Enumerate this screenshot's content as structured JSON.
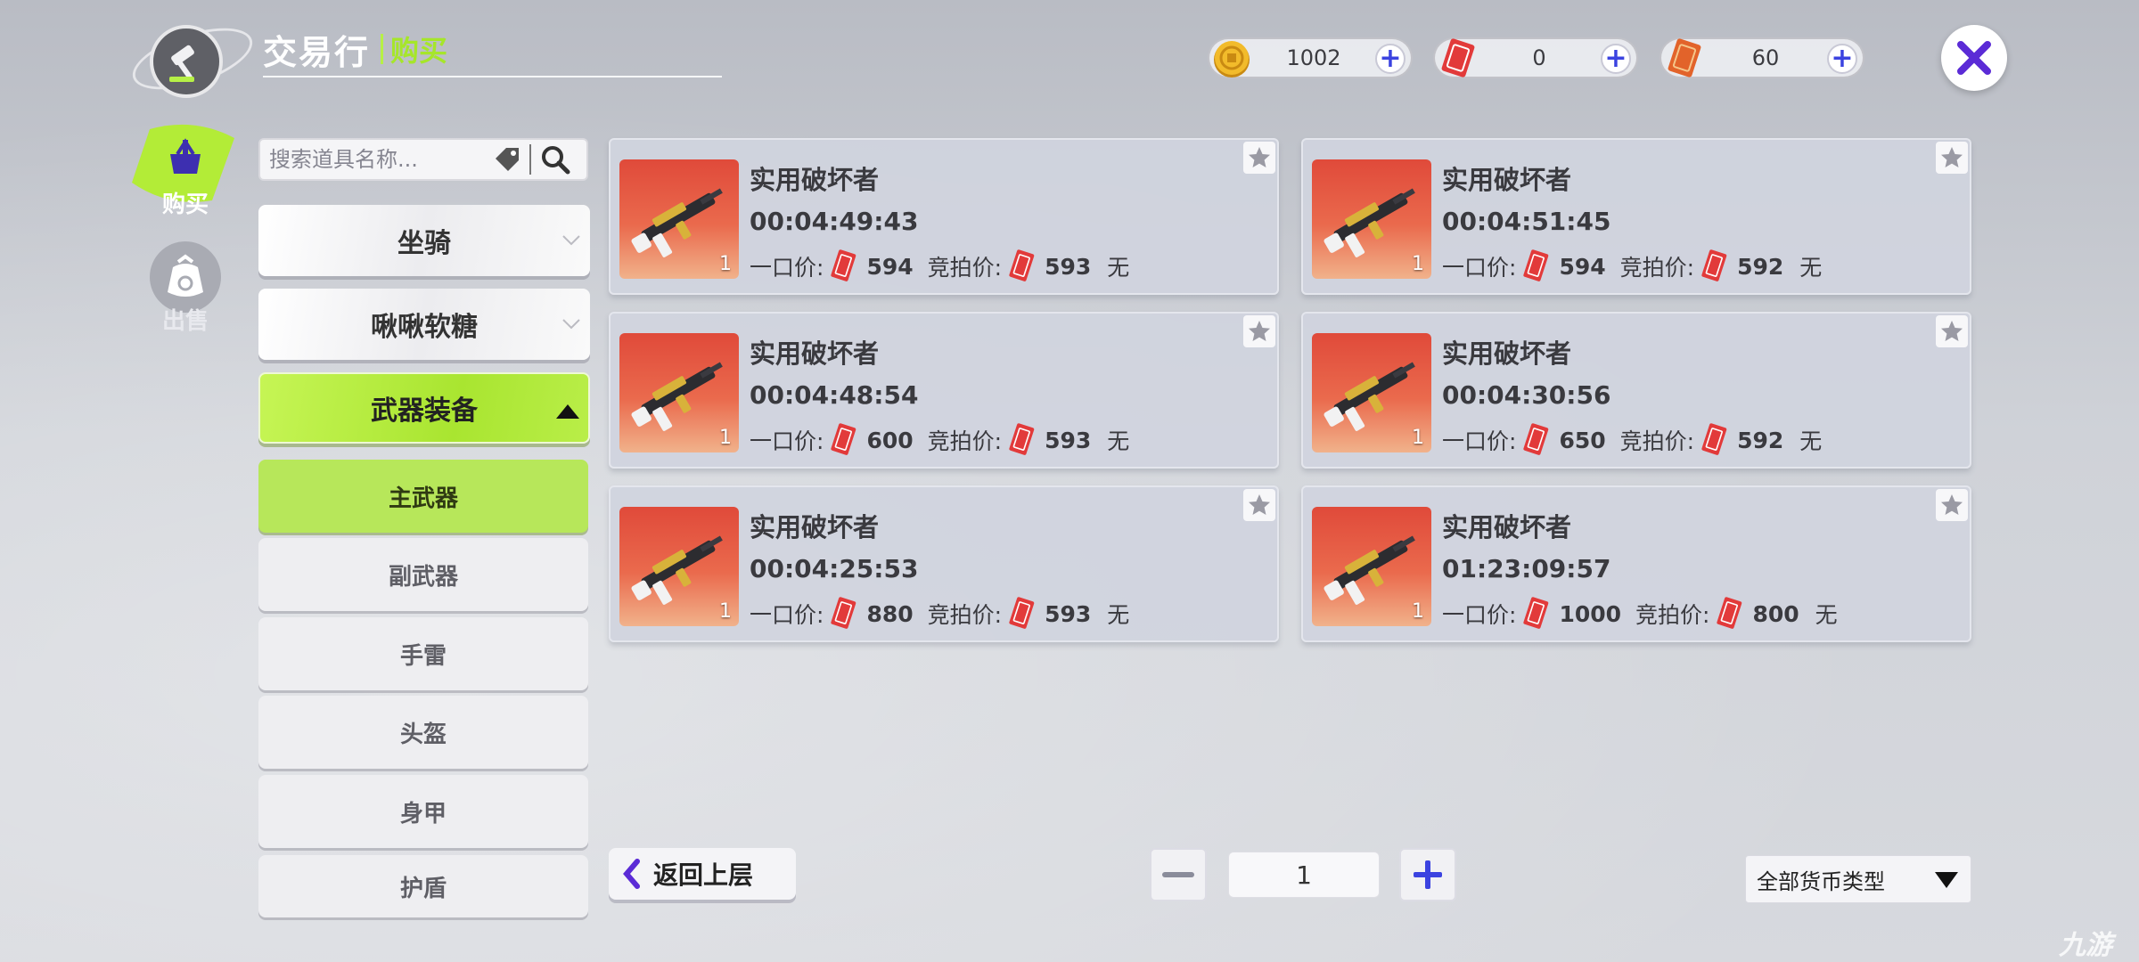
{
  "header": {
    "title": "交易行",
    "subtitle": "购买"
  },
  "currencies": [
    {
      "name": "gold-coin",
      "value": "1002"
    },
    {
      "name": "red-ticket",
      "value": "0"
    },
    {
      "name": "orange-ticket",
      "value": "60"
    }
  ],
  "sidebar": {
    "buy_label": "购买",
    "sell_label": "出售"
  },
  "search": {
    "placeholder": "搜索道具名称..."
  },
  "categories": {
    "mount": "坐骑",
    "candy": "啾啾软糖",
    "weapons": "武器装备",
    "subs": [
      "主武器",
      "副武器",
      "手雷",
      "头盔",
      "身甲",
      "护盾"
    ],
    "selected_sub": "主武器"
  },
  "labels": {
    "buyout": "一口价:",
    "bid": "竞拍价:",
    "bidder_none": "无"
  },
  "listings": [
    {
      "name": "实用破坏者",
      "timer": "00:04:49:43",
      "qty": "1",
      "buyout": "594",
      "bid": "593"
    },
    {
      "name": "实用破坏者",
      "timer": "00:04:51:45",
      "qty": "1",
      "buyout": "594",
      "bid": "592"
    },
    {
      "name": "实用破坏者",
      "timer": "00:04:48:54",
      "qty": "1",
      "buyout": "600",
      "bid": "593"
    },
    {
      "name": "实用破坏者",
      "timer": "00:04:30:56",
      "qty": "1",
      "buyout": "650",
      "bid": "592"
    },
    {
      "name": "实用破坏者",
      "timer": "00:04:25:53",
      "qty": "1",
      "buyout": "880",
      "bid": "593"
    },
    {
      "name": "实用破坏者",
      "timer": "01:23:09:57",
      "qty": "1",
      "buyout": "1000",
      "bid": "800"
    }
  ],
  "footer": {
    "back_label": "返回上层",
    "page": "1",
    "currency_filter": "全部货币类型"
  },
  "watermark": "九游",
  "colors": {
    "accent_green": "#a6e62a",
    "plus_blue": "#3b43e0",
    "close_purple": "#5b2bd6",
    "ticket_red": "#e23a3a"
  }
}
